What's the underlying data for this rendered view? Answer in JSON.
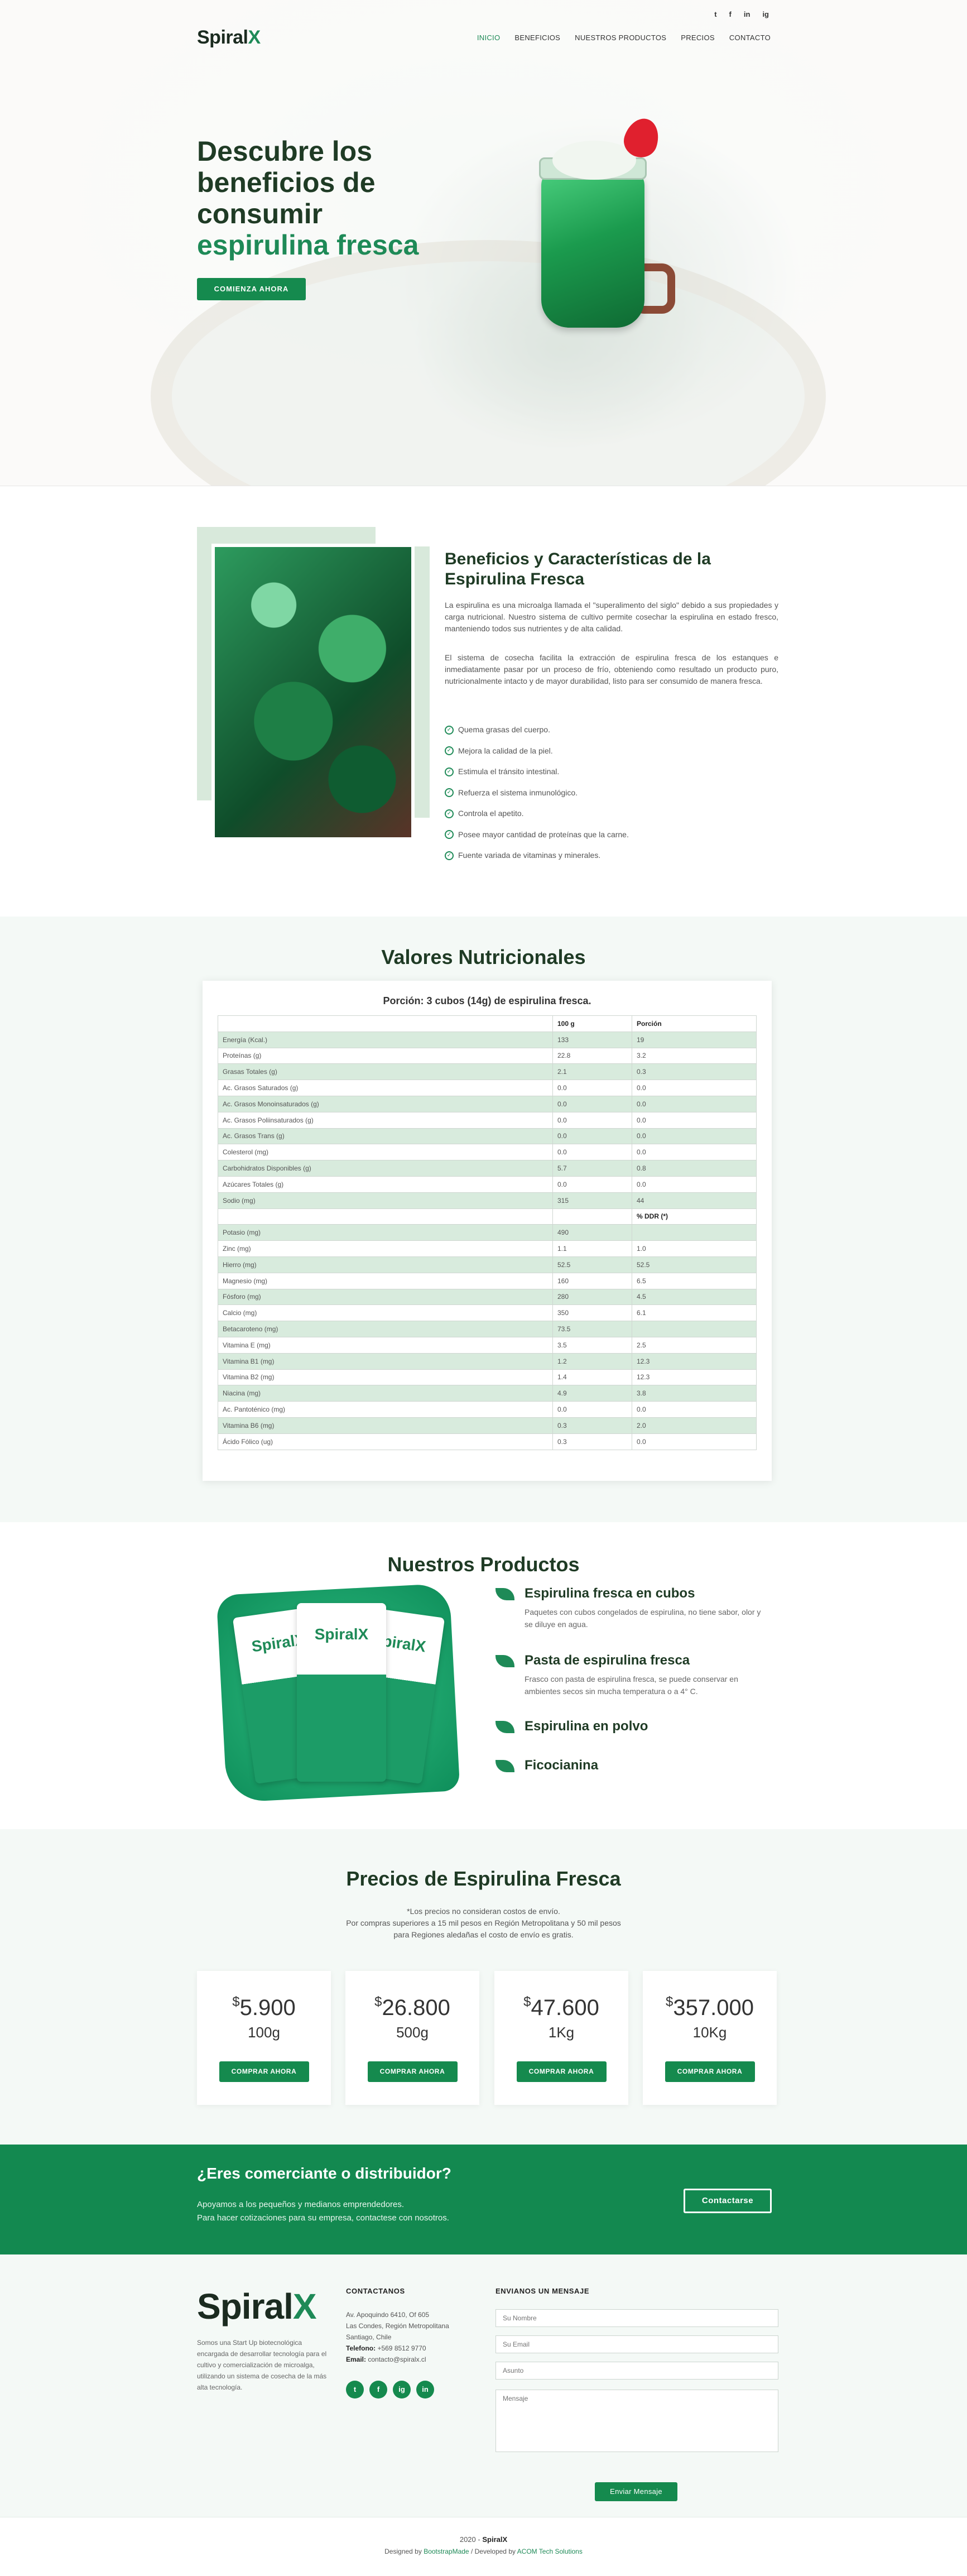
{
  "nav": {
    "social": [
      "t",
      "f",
      "in",
      "ig"
    ],
    "logo_main": "Spiral",
    "logo_x": "X",
    "menu": [
      "INICIO",
      "BENEFICIOS",
      "NUESTROS PRODUCTOS",
      "PRECIOS",
      "CONTACTO"
    ]
  },
  "hero": {
    "title_l1": "Descubre los",
    "title_l2": "beneficios de",
    "title_l3": "consumir",
    "title_hl": "espirulina fresca",
    "button": "COMIENZA AHORA"
  },
  "benefits": {
    "title": "Beneficios y Características de la Espirulina Fresca",
    "p1": "La espirulina es una microalga llamada el \"superalimento del siglo\" debido a sus propiedades y carga nutricional. Nuestro sistema de cultivo permite cosechar la espirulina en estado fresco, manteniendo todos sus nutrientes y de alta calidad.",
    "p2": "El sistema de cosecha facilita la extracción de espirulina fresca de los estanques e inmediatamente pasar por un proceso de frío, obteniendo como resultado un producto puro, nutricionalmente intacto y de mayor durabilidad, listo para ser consumido de manera fresca.",
    "list": [
      "Quema grasas del cuerpo.",
      "Mejora la calidad de la piel.",
      "Estimula el tránsito intestinal.",
      "Refuerza el sistema inmunológico.",
      "Controla el apetito.",
      "Posee mayor cantidad de proteínas que la carne.",
      "Fuente variada de vitaminas y minerales."
    ]
  },
  "nutrition": {
    "title": "Valores Nutricionales",
    "caption": "Porción: 3 cubos (14g) de espirulina fresca.",
    "headers": [
      "",
      "100 g",
      "Porción"
    ],
    "rows": [
      [
        "Energía (Kcal.)",
        "133",
        "19"
      ],
      [
        "Proteínas (g)",
        "22.8",
        "3.2"
      ],
      [
        "Grasas Totales (g)",
        "2.1",
        "0.3"
      ],
      [
        "Ac. Grasos Saturados (g)",
        "0.0",
        "0.0"
      ],
      [
        "Ac. Grasos Monoinsaturados (g)",
        "0.0",
        "0.0"
      ],
      [
        "Ac. Grasos Poliinsaturados (g)",
        "0.0",
        "0.0"
      ],
      [
        "Ac. Grasos Trans (g)",
        "0.0",
        "0.0"
      ],
      [
        "Colesterol (mg)",
        "0.0",
        "0.0"
      ],
      [
        "Carbohidratos Disponibles (g)",
        "5.7",
        "0.8"
      ],
      [
        "Azúcares Totales (g)",
        "0.0",
        "0.0"
      ],
      [
        "Sodio (mg)",
        "315",
        "44"
      ],
      [
        "",
        "",
        "% DDR (*)"
      ],
      [
        "Potasio (mg)",
        "490",
        ""
      ],
      [
        "Zinc (mg)",
        "1.1",
        "1.0"
      ],
      [
        "Hierro (mg)",
        "52.5",
        "52.5"
      ],
      [
        "Magnesio (mg)",
        "160",
        "6.5"
      ],
      [
        "Fósforo (mg)",
        "280",
        "4.5"
      ],
      [
        "Calcio (mg)",
        "350",
        "6.1"
      ],
      [
        "Betacaroteno (mg)",
        "73.5",
        ""
      ],
      [
        "Vitamina E (mg)",
        "3.5",
        "2.5"
      ],
      [
        "Vitamina B1 (mg)",
        "1.2",
        "12.3"
      ],
      [
        "Vitamina B2 (mg)",
        "1.4",
        "12.3"
      ],
      [
        "Niacina (mg)",
        "4.9",
        "3.8"
      ],
      [
        "Ac. Pantoténico (mg)",
        "0.0",
        "0.0"
      ],
      [
        "Vitamina B6 (mg)",
        "0.3",
        "2.0"
      ],
      [
        "Ácido Fólico (ug)",
        "0.3",
        "0.0"
      ]
    ]
  },
  "products": {
    "title": "Nuestros Productos",
    "bag_label": "SpiralX",
    "items": [
      {
        "name": "Espirulina fresca en cubos",
        "desc": "Paquetes con cubos congelados de espirulina, no tiene sabor, olor y se diluye en agua."
      },
      {
        "name": "Pasta de espirulina fresca",
        "desc": "Frasco con pasta de espirulina fresca, se puede conservar en ambientes secos sin mucha temperatura o a 4° C."
      },
      {
        "name": "Espirulina en polvo",
        "desc": ""
      },
      {
        "name": "Ficocianina",
        "desc": ""
      }
    ]
  },
  "prices": {
    "title": "Precios de Espirulina Fresca",
    "note1": "*Los precios no consideran costos de envío.",
    "note2": "Por compras superiores a 15 mil pesos en Región Metropolitana y 50 mil pesos",
    "note3": "para Regiones aledañas el costo de envío es gratis.",
    "currency": "$",
    "button": "COMPRAR AHORA",
    "items": [
      {
        "amount": "5.900",
        "qty": "100g"
      },
      {
        "amount": "26.800",
        "qty": "500g"
      },
      {
        "amount": "47.600",
        "qty": "1Kg"
      },
      {
        "amount": "357.000",
        "qty": "10Kg"
      }
    ]
  },
  "cta": {
    "title": "¿Eres comerciante o distribuidor?",
    "line1": "Apoyamos a los pequeños y medianos emprendedores.",
    "line2": "Para hacer cotizaciones para su empresa, contactese con nosotros.",
    "button": "Contactarse"
  },
  "footer": {
    "about": "Somos una Start Up biotecnológica encargada de desarrollar tecnología para el cultivo y comercialización de microalga, utilizando un sistema de cosecha de la más alta tecnología.",
    "contact_title": "CONTACTANOS",
    "address1": "Av. Apoquindo 6410, Of 605",
    "address2": "Las Condes, Región Metropolitana",
    "address3": "Santiago, Chile",
    "phone_label": "Telefono:",
    "phone": "+569 8512 9770",
    "email_label": "Email:",
    "email": "contacto@spiralx.cl",
    "social": [
      "t",
      "f",
      "ig",
      "in"
    ],
    "form_title": "ENVIANOS UN MENSAJE",
    "ph_name": "Su Nombre",
    "ph_email": "Su Email",
    "ph_subject": "Asunto",
    "ph_message": "Mensaje",
    "send": "Enviar Mensaje"
  },
  "copyright": {
    "year": "2020 -",
    "brand": "SpiralX",
    "designed_prefix": "Designed by",
    "designer": "BootstrapMade",
    "developed_prefix": "/ Developed by",
    "developer": "ACOM Tech Solutions"
  }
}
